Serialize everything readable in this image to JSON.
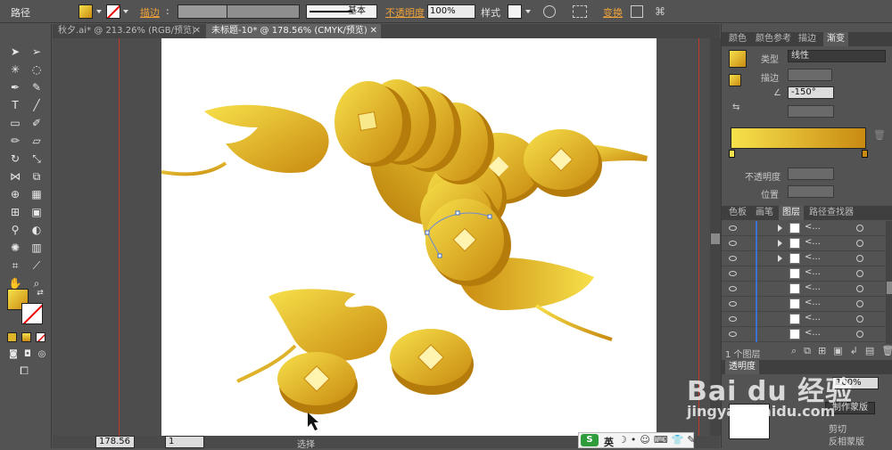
{
  "control_bar": {
    "selection_label": "路径",
    "stroke_label": "描边",
    "stroke_profile": "基本",
    "opacity_label": "不透明度",
    "opacity_value": "100%",
    "style_label": "样式",
    "transform_label": "变换"
  },
  "tabs": [
    {
      "label": "秋夕.ai* @ 213.26% (RGB/预览)"
    },
    {
      "label": "未标题-10* @ 178.56% (CMYK/预览)"
    }
  ],
  "status_bar": {
    "zoom": "178.56",
    "page": "1",
    "mode": "选择"
  },
  "gradient_panel": {
    "tabs": [
      "颜色",
      "颜色参考",
      "描边",
      "渐变"
    ],
    "type_label": "类型",
    "type_value": "线性",
    "stroke_label": "描边",
    "angle_value": "-150°",
    "opacity_label": "不透明度",
    "position_label": "位置",
    "colors": {
      "start": "#f6e14b",
      "end": "#c98a12"
    }
  },
  "layers_panel": {
    "tabs": [
      "色板",
      "画笔",
      "图层",
      "路径查找器"
    ],
    "rows": [
      {
        "name": "<..."
      },
      {
        "name": "<..."
      },
      {
        "name": "<..."
      },
      {
        "name": "<..."
      },
      {
        "name": "<..."
      },
      {
        "name": "<..."
      },
      {
        "name": "<..."
      },
      {
        "name": "<..."
      }
    ],
    "footer": "1 个图层"
  },
  "transparency_panel": {
    "title": "透明度",
    "opacity_value": "100%",
    "make_mask_button": "制作蒙版",
    "clip_label": "剪切",
    "invert_label": "反相蒙版"
  },
  "ime_bar": {
    "lang": "英"
  },
  "watermark": {
    "brand": "Bai du 经验",
    "url": "jingyan.baidu.com"
  },
  "colors": {
    "gold_light": "#f7e04a",
    "gold_dark": "#c8890f",
    "ui_bg": "#535353"
  }
}
